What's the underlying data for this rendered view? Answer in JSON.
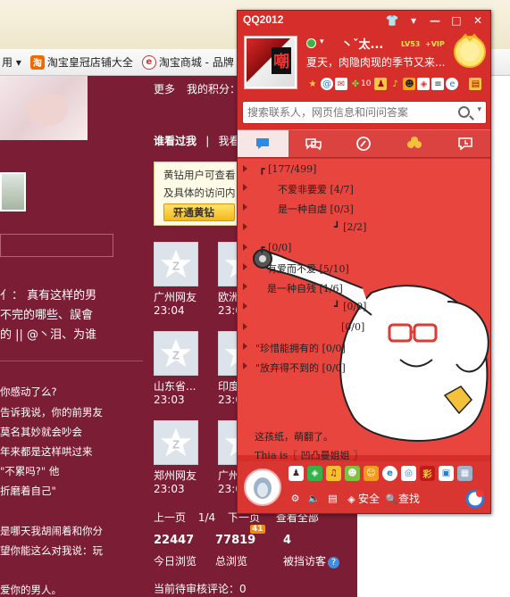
{
  "browser": {
    "bookmarks": [
      {
        "label": "用 ▾",
        "icon": "tab-menu-icon"
      },
      {
        "label": "淘宝皇冠店铺大全",
        "icon": "taobao-icon"
      },
      {
        "label": "淘宝商城 - 品牌",
        "icon": "tmall-icon"
      }
    ]
  },
  "page": {
    "more": "更多",
    "my_points": "我的积分：",
    "who_visited": "谁看过我",
    "who_sep": "|",
    "who_next": "我看",
    "gold_lines": [
      "黄钻用户可查看",
      "及具体的访问内"
    ],
    "gold_button": "开通黄钻",
    "left_text": [
      "亻：  真有这样的男",
      "不完的哪些、誤會",
      "的 || @丶泪、为谁"
    ],
    "left_text2": [
      "你感动了么?",
      "告诉我说，你的前男友",
      "莫名其妙就会吵会",
      "年来都是这样哄过来",
      "\"不累吗?\"        他",
      "折磨着自己\"",
      "",
      "是哪天我胡闹着和你分",
      "望你能这么对我说：玩",
      "",
      "",
      "爱你的男人。"
    ],
    "visitors": [
      {
        "name": "广州网友",
        "time": "23:04"
      },
      {
        "name": "欧洲",
        "time": "23:0"
      },
      {
        "name": "山东省...",
        "time": "23:03"
      },
      {
        "name": "印度",
        "time": "23:0"
      },
      {
        "name": "郑州网友",
        "time": "23:03"
      },
      {
        "name": "广州",
        "time": "23:0"
      }
    ],
    "pager": {
      "prev": "上一页",
      "page": "1/4",
      "next": "下一页",
      "all": "查看全部"
    },
    "stats": [
      {
        "value": "22447",
        "label": "今日浏览"
      },
      {
        "value": "77819",
        "label": "总浏览",
        "badge": "41"
      },
      {
        "value": "4",
        "label": "被挡访客"
      }
    ],
    "pending": "当前待审核评论：0"
  },
  "qq": {
    "title": "QQ2012",
    "nickname": "丶ˇ太...",
    "level": "LV53",
    "vip": "+VIP",
    "signature": "夏天，肉隐肉现的季节又来...",
    "tool_count": "10",
    "search_placeholder": "搜索联系人，网页信息和问问答案",
    "groups": [
      {
        "text": "┏  [177/499]",
        "indent": 24
      },
      {
        "text": "不爱非要爱  [4/7]",
        "indent": 45
      },
      {
        "text": "是一种自虐  [0/3]",
        "indent": 45
      },
      {
        "text": "┛  [2/2]",
        "indent": 108
      },
      {
        "text": "┏  [0/0]",
        "indent": 24
      },
      {
        "text": "有爱而不爱  [5/10]",
        "indent": 33
      },
      {
        "text": "是一种自残  [1/6]",
        "indent": 33
      },
      {
        "text": "┛  [0/0]",
        "indent": 108
      },
      {
        "text": "[0/0]",
        "indent": 116
      },
      {
        "text": "\"珍惜能拥有的   [0/0]",
        "indent": 20
      },
      {
        "text": "\"放弃得不到的   [0/0]",
        "indent": 20
      }
    ],
    "bottom_line1": "这孩纸，萌翻了。",
    "bottom_line2": "Thia is〖 凹凸曼姐姐 〗",
    "security_label": "安全",
    "find_label": "查找"
  }
}
